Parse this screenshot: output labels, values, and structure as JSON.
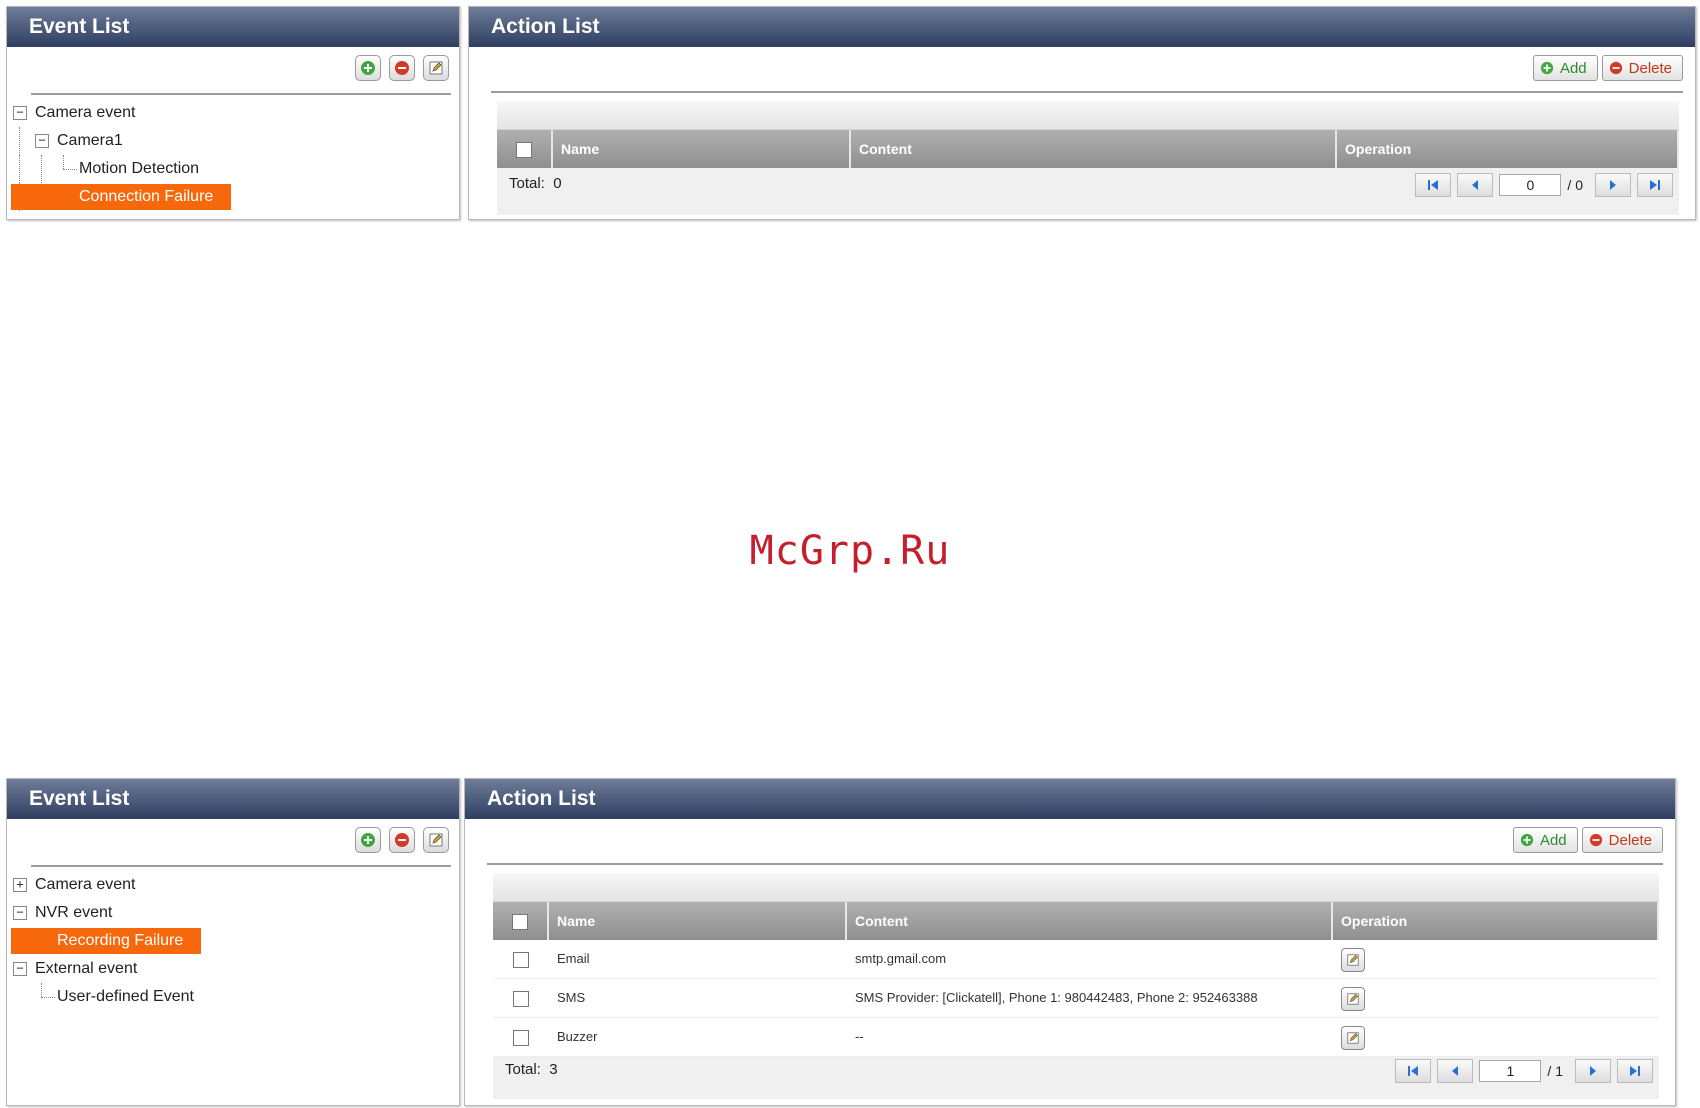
{
  "watermark": "McGrp.Ru",
  "screen1": {
    "event_panel": {
      "title": "Event List",
      "icons": [
        "add-icon",
        "delete-icon",
        "edit-icon"
      ],
      "tree": [
        "Camera event",
        "Camera1",
        "Motion Detection",
        "Connection Failure"
      ],
      "selected": "Connection Failure"
    },
    "action_panel": {
      "title": "Action List",
      "add_label": "Add",
      "delete_label": "Delete",
      "columns": [
        "Name",
        "Content",
        "Operation"
      ],
      "rows": [],
      "total_label": "Total:",
      "total": "0",
      "page": "0",
      "page_total": "/ 0"
    }
  },
  "screen2": {
    "event_panel": {
      "title": "Event List",
      "icons": [
        "add-icon",
        "delete-icon",
        "edit-icon"
      ],
      "tree": [
        "Camera event",
        "NVR event",
        "Recording Failure",
        "External event",
        "User-defined Event"
      ],
      "selected": "Recording Failure"
    },
    "action_panel": {
      "title": "Action List",
      "add_label": "Add",
      "delete_label": "Delete",
      "columns": [
        "Name",
        "Content",
        "Operation"
      ],
      "rows": [
        {
          "name": "Email",
          "content": "smtp.gmail.com"
        },
        {
          "name": "SMS",
          "content": "SMS Provider: [Clickatell], Phone 1: 980442483, Phone 2: 952463388"
        },
        {
          "name": "Buzzer",
          "content": "--"
        }
      ],
      "total_label": "Total:",
      "total": "3",
      "page": "1",
      "page_total": "/ 1"
    }
  },
  "colors": {
    "title_bar": "#3b4a6b",
    "selected": "#f7680c",
    "header": "#9a9a9a"
  }
}
